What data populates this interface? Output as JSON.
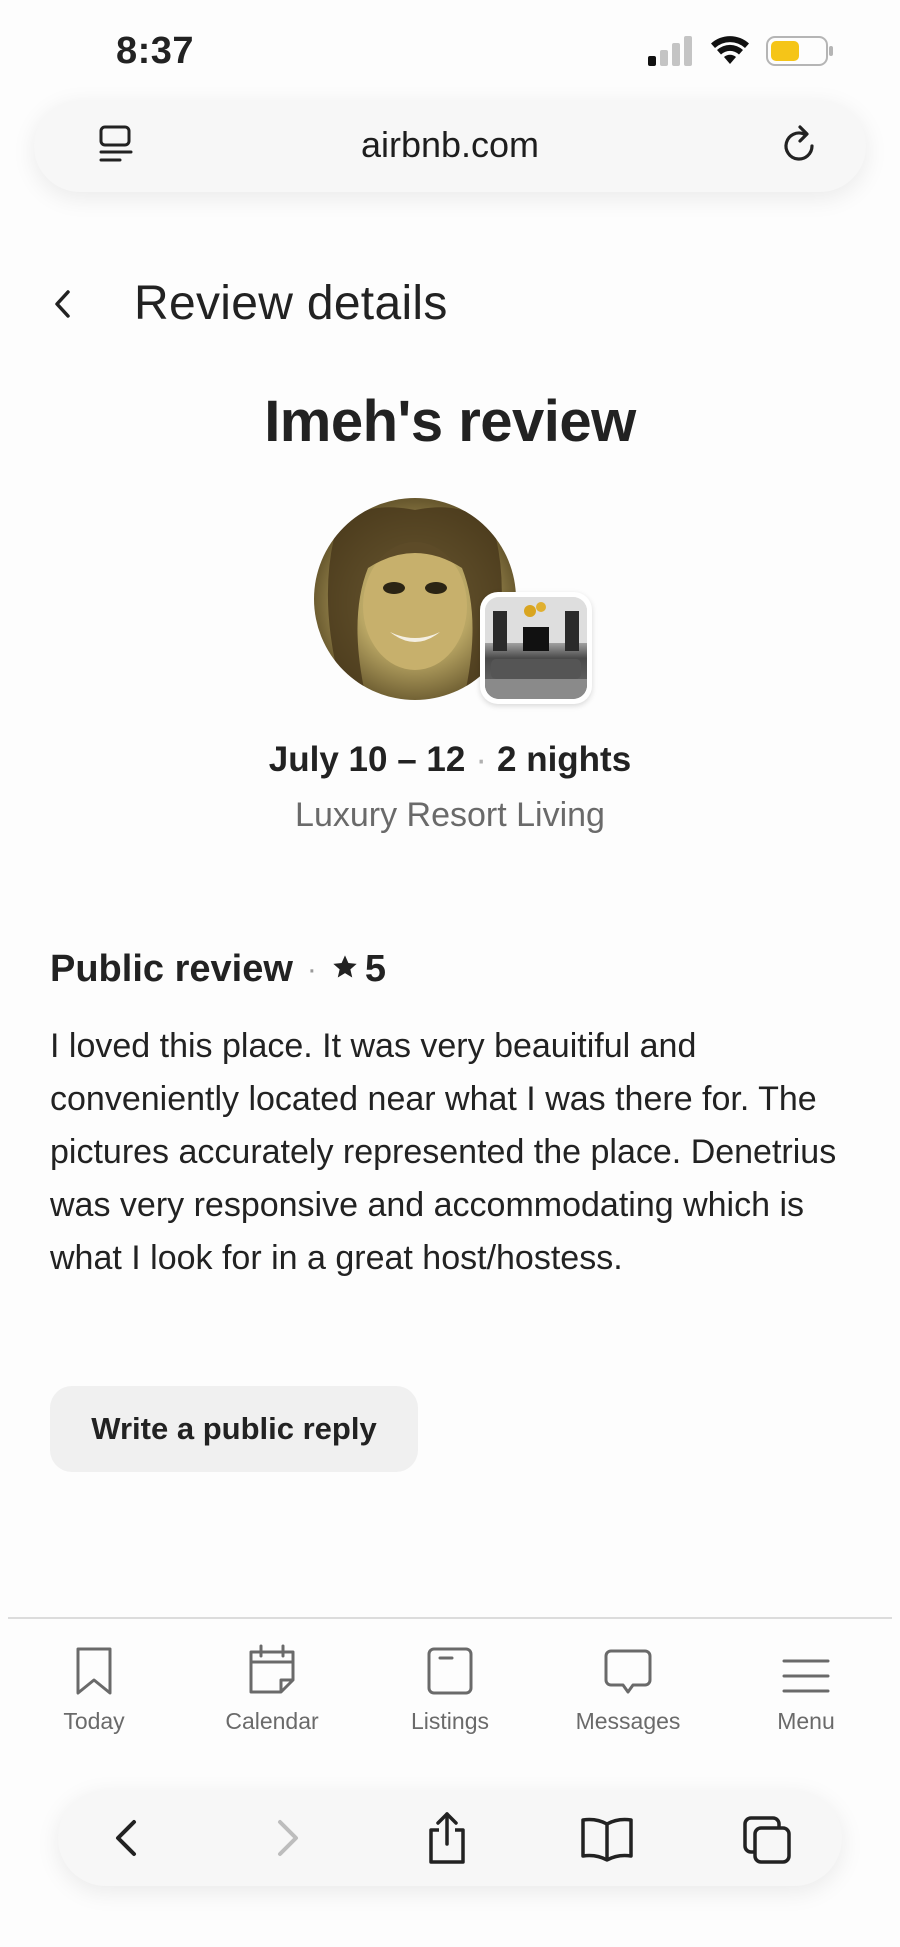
{
  "status_bar": {
    "time": "8:37",
    "signal_icon": "cellular-signal-icon",
    "wifi_icon": "wifi-icon",
    "battery_icon": "battery-icon",
    "battery_color": "#f5c518"
  },
  "browser": {
    "url": "airbnb.com",
    "reader_icon": "reader-mode-icon",
    "reload_icon": "reload-icon"
  },
  "header": {
    "back_icon": "chevron-left-icon",
    "title": "Review details"
  },
  "review": {
    "heading": "Imeh's review",
    "guest_avatar": "guest-avatar",
    "listing_thumbnail": "listing-thumbnail",
    "dates": "July 10 – 12",
    "separator": "·",
    "nights": "2 nights",
    "listing_name": "Luxury Resort Living"
  },
  "public_review": {
    "label": "Public review",
    "separator": "·",
    "star_icon": "star-icon",
    "rating": "5",
    "text": "I loved this place. It was very beauitiful and conveniently located near what I was there for. The pictures accurately represented the place. Denetrius was very responsive and accommodating which is what I look for in a great host/hostess.",
    "reply_button": "Write a public reply"
  },
  "tabbar": {
    "items": [
      {
        "label": "Today",
        "icon": "bookmark-icon"
      },
      {
        "label": "Calendar",
        "icon": "calendar-icon"
      },
      {
        "label": "Listings",
        "icon": "listings-icon"
      },
      {
        "label": "Messages",
        "icon": "message-icon"
      },
      {
        "label": "Menu",
        "icon": "menu-icon"
      }
    ]
  },
  "safari_toolbar": {
    "back_icon": "back-arrow-icon",
    "forward_icon": "forward-arrow-icon",
    "share_icon": "share-icon",
    "bookmarks_icon": "book-icon",
    "tabs_icon": "tabs-icon"
  },
  "colors": {
    "text_primary": "#222222",
    "text_secondary": "#6a6a6a",
    "button_bg": "#f0f0f0"
  }
}
